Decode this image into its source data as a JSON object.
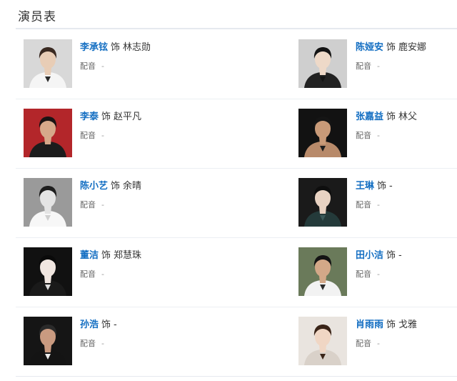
{
  "section_title": "演员表",
  "cast": [
    {
      "actor": "李承铉",
      "prefix": "饰",
      "role": "林志勋",
      "dub_label": "配音",
      "dub_value": "-",
      "photo": {
        "bg": "#d8d8d8",
        "skin": "#e8cdb6",
        "hair": "#3a2a22",
        "cloth": "#f5f5f5",
        "accent": "#2a2a2a"
      }
    },
    {
      "actor": "陈娅安",
      "prefix": "饰",
      "role": "鹿安娜",
      "dub_label": "配音",
      "dub_value": "-",
      "photo": {
        "bg": "#cfcfcf",
        "skin": "#eed9c8",
        "hair": "#141414",
        "cloth": "#222222",
        "accent": "#141414"
      }
    },
    {
      "actor": "李泰",
      "prefix": "饰",
      "role": "赵平凡",
      "dub_label": "配音",
      "dub_value": "-",
      "photo": {
        "bg": "#b3262a",
        "skin": "#d6a98a",
        "hair": "#1a1414",
        "cloth": "#1c1c1c",
        "accent": "#1c1c1c"
      }
    },
    {
      "actor": "张嘉益",
      "prefix": "饰",
      "role": "林父",
      "dub_label": "配音",
      "dub_value": "-",
      "photo": {
        "bg": "#121212",
        "skin": "#c99a78",
        "hair": "#151515",
        "cloth": "#b88a6a",
        "accent": "#1d1d1d"
      }
    },
    {
      "actor": "陈小艺",
      "prefix": "饰",
      "role": "余晴",
      "dub_label": "配音",
      "dub_value": "-",
      "photo": {
        "bg": "#9a9a9a",
        "skin": "#e4e4e4",
        "hair": "#1e1e1e",
        "cloth": "#f7f7f7",
        "accent": "#cfcfcf"
      }
    },
    {
      "actor": "王琳",
      "prefix": "饰",
      "role": "-",
      "dub_label": "配音",
      "dub_value": "-",
      "photo": {
        "bg": "#1a1a1a",
        "skin": "#e8d2c2",
        "hair": "#0e0e0e",
        "cloth": "#243a3a",
        "accent": "#3b5a5a"
      }
    },
    {
      "actor": "董洁",
      "prefix": "饰",
      "role": "郑慧珠",
      "dub_label": "配音",
      "dub_value": "-",
      "photo": {
        "bg": "#111111",
        "skin": "#f0e6e0",
        "hair": "#0a0a0a",
        "cloth": "#1a1a1a",
        "accent": "#e0e0e0"
      }
    },
    {
      "actor": "田小洁",
      "prefix": "饰",
      "role": "-",
      "dub_label": "配音",
      "dub_value": "-",
      "photo": {
        "bg": "#6a7a5a",
        "skin": "#d3a888",
        "hair": "#141414",
        "cloth": "#f2f2f2",
        "accent": "#2b2b2b"
      }
    },
    {
      "actor": "孙浩",
      "prefix": "饰",
      "role": "-",
      "dub_label": "配音",
      "dub_value": "-",
      "photo": {
        "bg": "#151515",
        "skin": "#c99a80",
        "hair": "#2a2a2a",
        "cloth": "#141414",
        "accent": "#ededed"
      }
    },
    {
      "actor": "肖雨雨",
      "prefix": "饰",
      "role": "戈雅",
      "dub_label": "配音",
      "dub_value": "-",
      "photo": {
        "bg": "#e9e4df",
        "skin": "#f0d6c4",
        "hair": "#3a2418",
        "cloth": "#d9d1c9",
        "accent": "#3a2418"
      }
    }
  ]
}
